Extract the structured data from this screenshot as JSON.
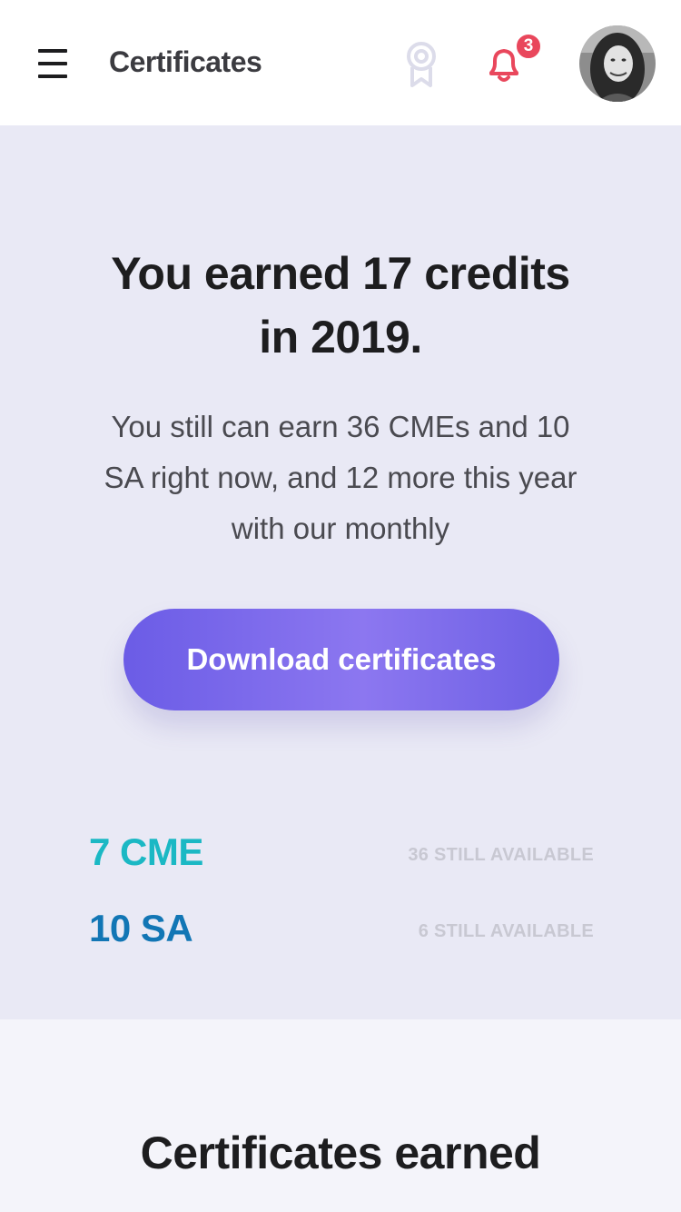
{
  "header": {
    "title": "Certificates",
    "notification_count": "3",
    "icons": {
      "menu": "menu-icon",
      "award": "award-icon",
      "bell": "bell-icon",
      "avatar": "user-avatar"
    }
  },
  "summary": {
    "headline": "You earned 17 credits in 2019.",
    "body": "You still can earn 36 CMEs and 10 SA right now, and 12 more this year with our monthly",
    "download_label": "Download certificates",
    "credits": [
      {
        "amount": "7 CME",
        "available": "36 STILL AVAILABLE",
        "color": "#1bb8c4"
      },
      {
        "amount": "10 SA",
        "available": "6 STILL AVAILABLE",
        "color": "#1276b5"
      }
    ]
  },
  "earned": {
    "title": "Certificates earned"
  },
  "colors": {
    "accent": "#6f60e8",
    "notification": "#e9475c",
    "summary_bg": "#e9e9f5",
    "award_icon": "#dcdcea"
  }
}
